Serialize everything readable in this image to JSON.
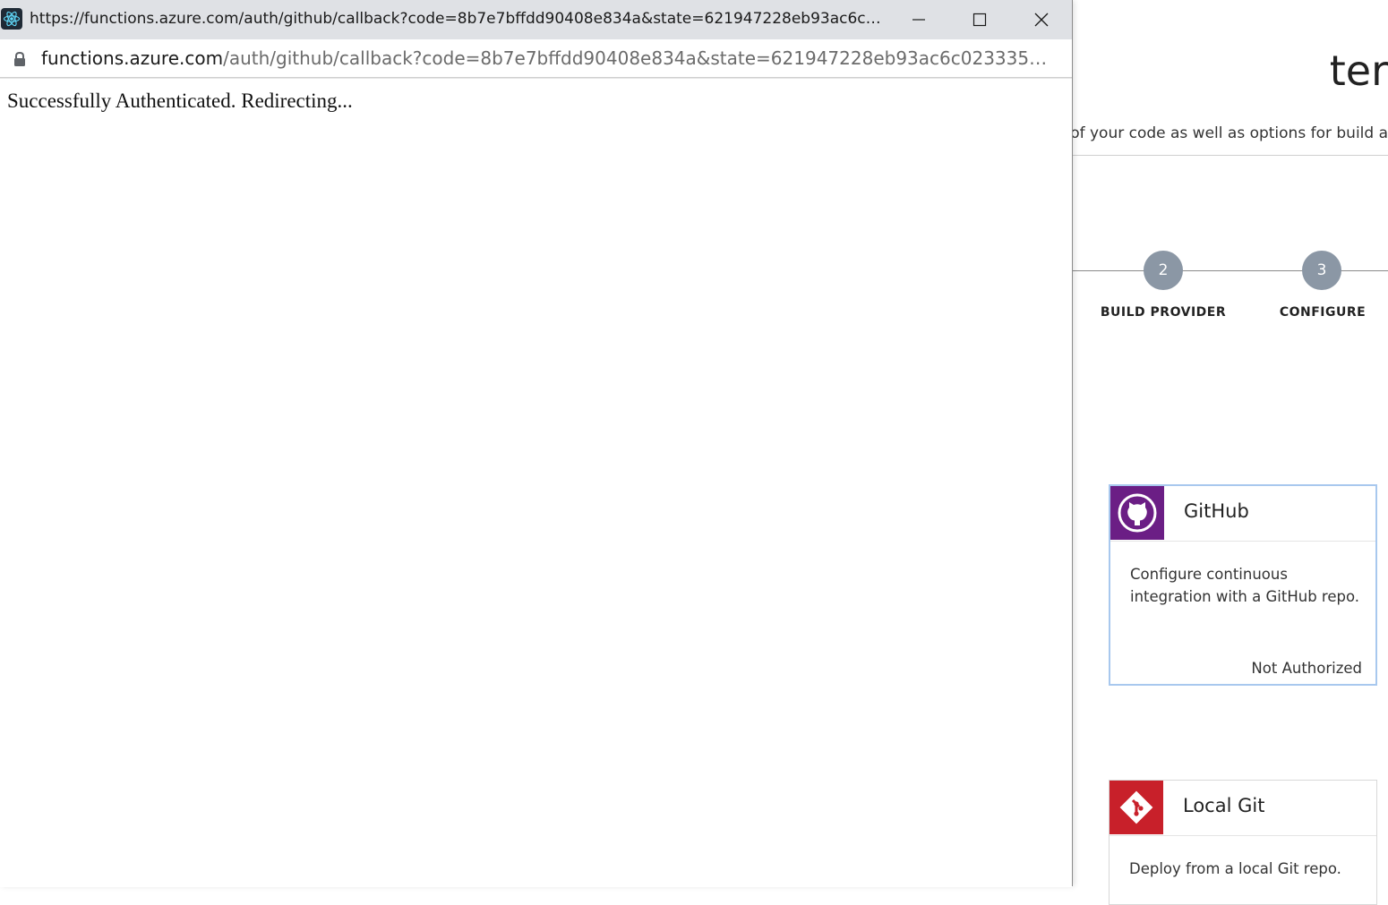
{
  "popup": {
    "title_url": "https://functions.azure.com/auth/github/callback?code=8b7e7bffdd90408e834a&state=621947228eb93ac6c0233356e...",
    "address": {
      "host": "functions.azure.com",
      "path": "/auth/github/callback?code=8b7e7bffdd90408e834a&state=621947228eb93ac6c0233356ea8d49ee..."
    },
    "message": "Successfully Authenticated. Redirecting..."
  },
  "background": {
    "title_fragment": "ter",
    "subtitle_fragment": "on of your code as well as options for build a",
    "steps": [
      {
        "number": "2",
        "label": "BUILD PROVIDER"
      },
      {
        "number": "3",
        "label": "CONFIGURE"
      }
    ],
    "cards": [
      {
        "title": "GitHub",
        "description": "Configure continuous integration with a GitHub repo.",
        "status": "Not Authorized",
        "logo_color": "#6b1e85",
        "icon": "github-icon"
      },
      {
        "title": "Local Git",
        "description": "Deploy from a local Git repo.",
        "logo_color": "#c8202a",
        "icon": "git-icon"
      }
    ]
  },
  "colors": {
    "titlebar_bg": "#dfe1e5",
    "step_circle": "#8b97a5",
    "selected_card_border": "#a8c8ee"
  }
}
